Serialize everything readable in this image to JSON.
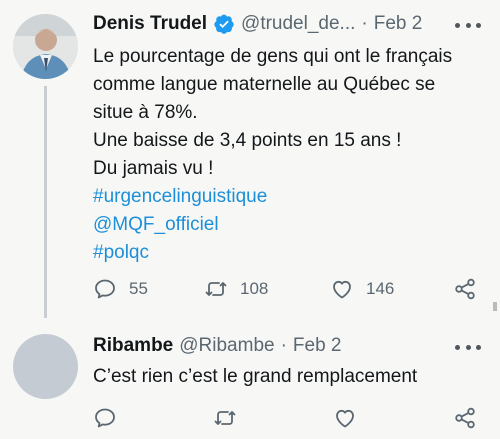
{
  "tweet1": {
    "name": "Denis Trudel",
    "handle": "@trudel_de...",
    "dot": "·",
    "date": "Feb 2",
    "text_lines": [
      "Le pourcentage de gens qui ont le français",
      "comme langue maternelle au Québec se",
      "situe à 78%.",
      "Une baisse de 3,4 points en 15 ans !",
      "Du jamais vu !"
    ],
    "hashtags": [
      "#urgencelinguistique",
      "@MQF_officiel",
      "#polqc"
    ],
    "replies": "55",
    "retweets": "108",
    "likes": "146"
  },
  "tweet2": {
    "name": "Ribambe",
    "handle": "@Ribambe",
    "dot": "·",
    "date": "Feb 2",
    "text": "C’est rien c’est le grand remplacement"
  },
  "icons": {
    "verified": "verified-badge-icon",
    "more": "more-options-icon",
    "reply": "reply-icon",
    "retweet": "retweet-icon",
    "like": "heart-icon",
    "share": "share-icon"
  },
  "colors": {
    "background": "#f7f8f6",
    "link": "#1d8fd8",
    "verified": "#1d9bf0",
    "secondary_text": "#5b6770"
  }
}
